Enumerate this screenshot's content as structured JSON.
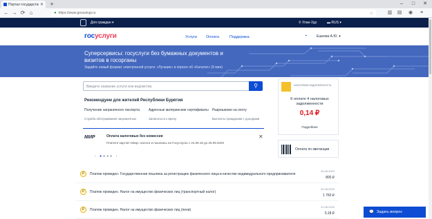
{
  "browser": {
    "tab_title": "Портал государствен",
    "url": "https://www.gosuslugi.ru",
    "new_tab": "+",
    "min": "–",
    "max": "□",
    "close": "✕",
    "back": "←",
    "forward": "→",
    "reload": "⟳",
    "home": "⌂"
  },
  "topbar": {
    "menu": "Для граждан",
    "location": "Улан-Удэ",
    "lang": "RUS"
  },
  "header": {
    "logo_part1": "гос",
    "logo_part2": "услуги",
    "nav": [
      "Услуги",
      "Оплата",
      "Поддержка"
    ],
    "user": "Ешеева А.Ю."
  },
  "hero": {
    "title": "Суперсервисы: госуслуги без бумажных документов и визитов в госорганы",
    "subtitle": "Задайте новый формат электронной услуги: «Лучшие» в опросе об «Каталог» (9 мин)"
  },
  "search": {
    "placeholder": "Введите название услуги или ведомства",
    "button_icon": "search-icon"
  },
  "recommend": {
    "title": "Рекомендуем для жителей Республики Бурятия",
    "columns": [
      {
        "head": "Получение заграничного паспорта",
        "sub": "Служба обслуживания заграничных"
      },
      {
        "head": "Адресные материнские сертификаты",
        "sub": "Записаться к врачу"
      },
      {
        "head": "Разрешение на охоту",
        "sub": "Выплаты гражданам с доходами"
      }
    ]
  },
  "promo": {
    "brand": "МИР",
    "title": "Оплата налоговых без комиссии",
    "text": "Платите картой «Мир» налоги и пошлины на Госуслугах   с 24.08.18 до 25.09.2020",
    "close": "✕",
    "dots": [
      "●",
      "●",
      "●",
      "●"
    ]
  },
  "tax_card": {
    "stub_text": "НАЛОГОВАЯ ЗАДОЛЖЕННОСТЬ",
    "caption": "К оплате 4 налоговых задолженности",
    "amount": "0,14 ₽",
    "more": "Подробнее"
  },
  "qr_card": {
    "label": "Оплата по квитанции"
  },
  "feed": [
    {
      "title": "Платеж проведен. Государственная пошлина за регистрацию физического лица в качестве индивидуального предпринимателя",
      "date": "25.08.2020",
      "amount": "800 ₽"
    },
    {
      "title": "Платеж проведен. Налог на имущество физических лиц (транспортный налог)",
      "date": "24.08.2020",
      "amount": "1 760 ₽"
    },
    {
      "title": "Платеж проведен. Налог на имущество физических лиц (пени)",
      "date": "21.08.2020",
      "amount": "0,18 ₽"
    }
  ],
  "ask": {
    "label": "Задать вопрос"
  }
}
